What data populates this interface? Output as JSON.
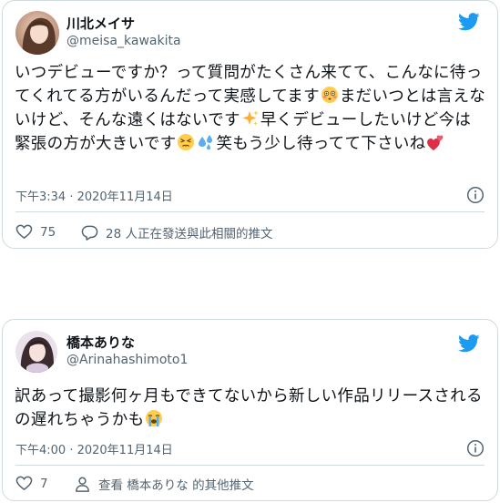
{
  "tweets": [
    {
      "display_name": "川北メイサ",
      "handle": "@meisa_kawakita",
      "text_parts": [
        "いつデビューですか？って質問がたくさん来てて、こんなに待ってくれてる方がいるんだって実感してます",
        "まだいつとは言えないけど、そんな遠くはないです",
        "早くデビューしたいけど今は緊張の方が大きいです",
        "",
        "笑もう少し待ってて下さいね"
      ],
      "emoji": [
        "flushed-face",
        "sparkles",
        "persevering-face",
        "sweat-droplets",
        "two-hearts"
      ],
      "timestamp": "下午3:34 · 2020年11月14日",
      "like_count": "75",
      "reply_text": "28 人正在發送與此相關的推文"
    },
    {
      "display_name": "橋本ありな",
      "handle": "@Arinahashimoto1",
      "text_parts": [
        "訳あって撮影何ヶ月もできてないから新しい作品リリースされるの遅れちゃうかも"
      ],
      "emoji": [
        "loudly-crying-face"
      ],
      "timestamp": "下午4:00 · 2020年11月14日",
      "like_count": "7",
      "profile_text": "查看 橋本ありな 的其他推文"
    }
  ],
  "colors": {
    "twitter_blue": "#1d9bf0",
    "text_primary": "#0f1419",
    "text_secondary": "#536471",
    "border": "#cfd9de"
  }
}
